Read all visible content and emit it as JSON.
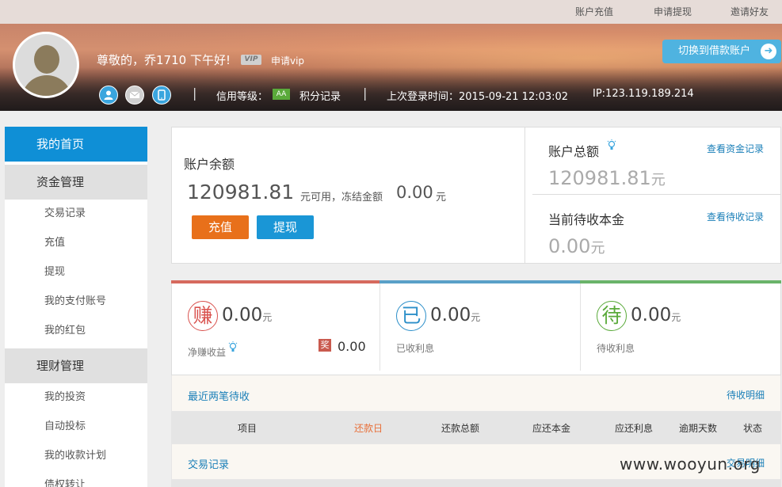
{
  "topbar": {
    "links": [
      "账户充值",
      "申请提现",
      "邀请好友"
    ]
  },
  "header": {
    "greeting": "尊敬的，乔1710  下午好!",
    "vip_badge": "VIP",
    "apply_vip": "申请vip",
    "credit_label": "信用等级：",
    "credit_level": "AA",
    "points_record": "积分记录",
    "last_login": "上次登录时间：2015-09-21 12:03:02",
    "ip": "IP:123.119.189.214",
    "switch_button": "切换到借款账户",
    "icons": [
      "user-icon",
      "mail-icon",
      "mobile-icon"
    ]
  },
  "sidebar": {
    "home": "我的首页",
    "sections": [
      {
        "title": "资金管理",
        "items": [
          "交易记录",
          "充值",
          "提现",
          "我的支付账号",
          "我的红包"
        ]
      },
      {
        "title": "理财管理",
        "items": [
          "我的投资",
          "自动投标",
          "我的收款计划",
          "债权转让"
        ]
      }
    ]
  },
  "balance": {
    "label": "账户余额",
    "available": "120981.81",
    "available_suffix": "元可用，冻结金额",
    "frozen": "0.00",
    "frozen_unit": "元",
    "recharge_button": "充值",
    "withdraw_button": "提现"
  },
  "totals": {
    "total_label": "账户总额",
    "total_value": "120981.81",
    "total_unit": "元",
    "total_link": "查看资金记录",
    "principal_label": "当前待收本金",
    "principal_value": "0.00",
    "principal_unit": "元",
    "principal_link": "查看待收记录"
  },
  "stats": [
    {
      "glyph": "赚",
      "value": "0.00",
      "unit": "元",
      "label": "净赚收益",
      "color": "#d9534f"
    },
    {
      "glyph": "已",
      "value": "0.00",
      "unit": "元",
      "label": "已收利息",
      "color": "#2c8fc9"
    },
    {
      "glyph": "待",
      "value": "0.00",
      "unit": "元",
      "label": "待收利息",
      "color": "#5aaa3a"
    }
  ],
  "reward": {
    "glyph": "奖",
    "value": "0.00"
  },
  "recent": {
    "title": "最近两笔待收",
    "detail_link": "待收明细",
    "columns": [
      "项目",
      "还款日",
      "还款总额",
      "应还本金",
      "应还利息",
      "逾期天数",
      "状态"
    ]
  },
  "transactions": {
    "title": "交易记录",
    "detail_link": "交易明细"
  },
  "watermark": "www.wooyun.org",
  "colors": {
    "accent_blue": "#0f8fd6",
    "recharge_orange": "#e8701a",
    "withdraw_blue": "#1a96d6",
    "highlight_red": "#e8703a"
  }
}
